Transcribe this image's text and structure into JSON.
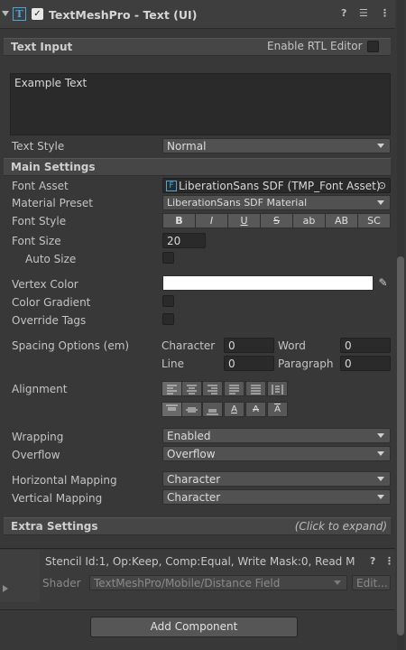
{
  "header": {
    "title": "TextMeshPro - Text (UI)",
    "enabled": true,
    "icons": [
      "help-icon",
      "presets-icon",
      "more-icon"
    ]
  },
  "text_input": {
    "section_label": "Text Input",
    "rtl_label": "Enable RTL Editor",
    "rtl_enabled": false,
    "text_value": "Example Text",
    "text_style_label": "Text Style",
    "text_style_value": "Normal"
  },
  "main_settings": {
    "section_label": "Main Settings",
    "font_asset_label": "Font Asset",
    "font_asset_value": "LiberationSans SDF (TMP_Font Asset)",
    "material_preset_label": "Material Preset",
    "material_preset_value": "LiberationSans SDF Material",
    "font_style_label": "Font Style",
    "font_style_buttons": [
      "B",
      "I",
      "U",
      "S",
      "ab",
      "AB",
      "SC"
    ],
    "font_size_label": "Font Size",
    "font_size_value": "20",
    "auto_size_label": "Auto Size",
    "vertex_color_label": "Vertex Color",
    "vertex_color_value": "#FFFFFF",
    "color_gradient_label": "Color Gradient",
    "override_tags_label": "Override Tags",
    "spacing_label": "Spacing Options (em)",
    "spacing": {
      "character_label": "Character",
      "character_value": "0",
      "word_label": "Word",
      "word_value": "0",
      "line_label": "Line",
      "line_value": "0",
      "paragraph_label": "Paragraph",
      "paragraph_value": "0"
    },
    "alignment_label": "Alignment",
    "wrapping_label": "Wrapping",
    "wrapping_value": "Enabled",
    "overflow_label": "Overflow",
    "overflow_value": "Overflow",
    "horizontal_mapping_label": "Horizontal Mapping",
    "horizontal_mapping_value": "Character",
    "vertical_mapping_label": "Vertical Mapping",
    "vertical_mapping_value": "Character"
  },
  "extra_settings": {
    "section_label": "Extra Settings",
    "hint": "(Click to expand)"
  },
  "material": {
    "stencil_text": "Stencil Id:1, Op:Keep, Comp:Equal, Write Mask:0, Read M",
    "shader_label": "Shader",
    "shader_value": "TextMeshPro/Mobile/Distance Field",
    "edit_label": "Edit..."
  },
  "footer": {
    "add_component_label": "Add Component"
  }
}
